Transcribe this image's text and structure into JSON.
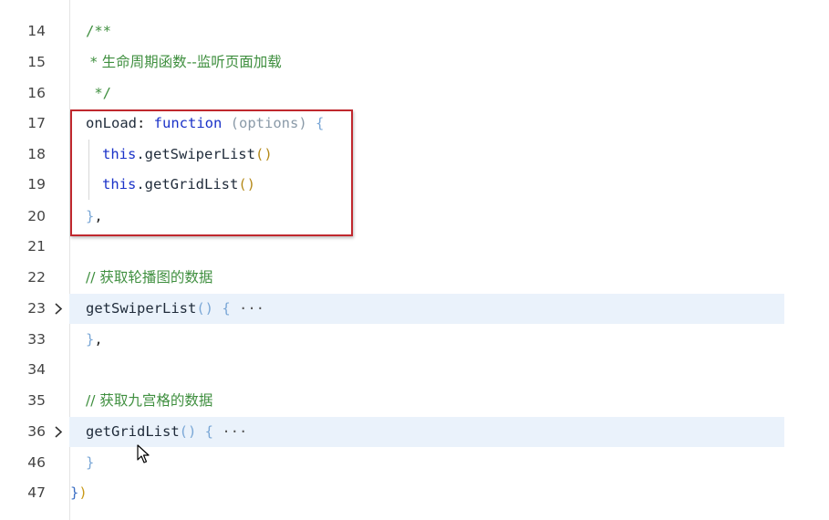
{
  "editor": {
    "lines": [
      {
        "num": "14",
        "text": "/**"
      },
      {
        "num": "15",
        "text": " * 生命周期函数--监听页面加载"
      },
      {
        "num": "16",
        "text": " */"
      },
      {
        "num": "17",
        "fn": "onLoad",
        "colon": ": ",
        "kw": "function",
        "param": " (options)",
        "brace": " {"
      },
      {
        "num": "18",
        "this": "this",
        "call": ".getSwiperList",
        "parens": "()"
      },
      {
        "num": "19",
        "this": "this",
        "call": ".getGridList",
        "parens": "()"
      },
      {
        "num": "20",
        "brace": "}",
        "punct": ","
      },
      {
        "num": "21"
      },
      {
        "num": "22",
        "text": "// 获取轮播图的数据"
      },
      {
        "num": "23",
        "fn": "getSwiperList",
        "parens": "()",
        "brace": " {",
        "ellipsis": "···"
      },
      {
        "num": "33",
        "brace": "}",
        "punct": ","
      },
      {
        "num": "34"
      },
      {
        "num": "35",
        "text": "// 获取九宫格的数据"
      },
      {
        "num": "36",
        "fn": "getGridList",
        "parens": "()",
        "brace": " {",
        "ellipsis": "···"
      },
      {
        "num": "46",
        "brace": "}"
      },
      {
        "num": "47",
        "brace_a": "}",
        "brace_b": ")"
      }
    ]
  },
  "colors": {
    "comment": "#3f8f3f",
    "keyword": "#1a32c8",
    "brace": "#7aa7d6",
    "highlight_box": "#c0282e",
    "fold_highlight": "#eaf2fb"
  },
  "icons": {
    "fold": "chevron-right-icon",
    "cursor": "mouse-pointer-icon"
  }
}
